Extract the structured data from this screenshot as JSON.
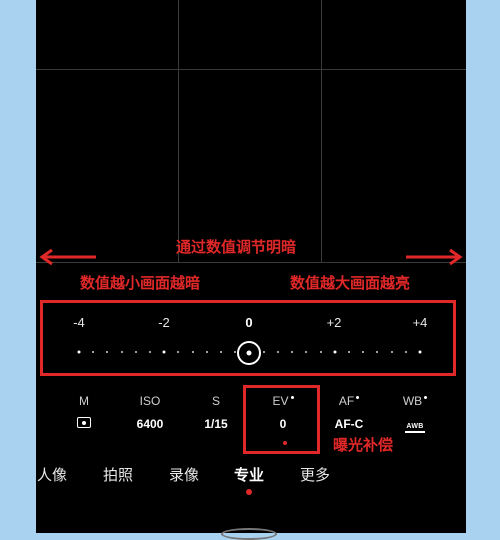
{
  "annotations": {
    "top_line": "通过数值调节明暗",
    "left_hint": "数值越小画面越暗",
    "right_hint": "数值越大画面越亮",
    "ev_label": "曝光补偿",
    "accent_color": "#e02828"
  },
  "ev_scale": {
    "ticks": [
      "-4",
      "-2",
      "0",
      "+2",
      "+4"
    ],
    "current_value": 0
  },
  "params": [
    {
      "label": "M",
      "value_icon": "metering-icon"
    },
    {
      "label": "ISO",
      "value": "6400"
    },
    {
      "label": "S",
      "value": "1/15"
    },
    {
      "label": "EV",
      "value": "0"
    },
    {
      "label": "AF",
      "value": "AF-C"
    },
    {
      "label": "WB",
      "value_icon": "awb-icon",
      "icon_text": "AWB"
    }
  ],
  "modes": [
    {
      "label": "人像"
    },
    {
      "label": "拍照"
    },
    {
      "label": "录像"
    },
    {
      "label": "专业",
      "active": true
    },
    {
      "label": "更多"
    }
  ]
}
